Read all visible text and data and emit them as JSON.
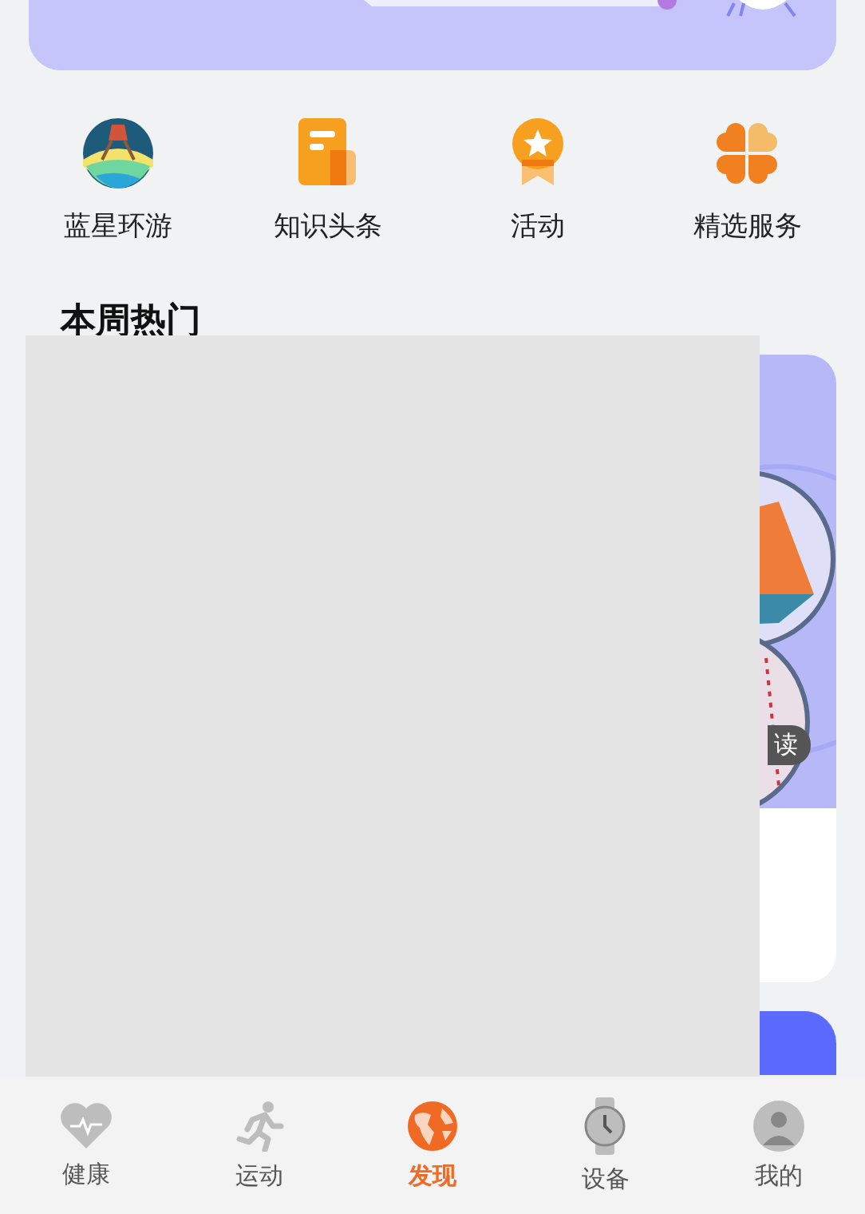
{
  "shortcuts": [
    {
      "kind": "globe",
      "label": "蓝星环游"
    },
    {
      "kind": "document",
      "label": "知识头条"
    },
    {
      "kind": "medal",
      "label": "活动"
    },
    {
      "kind": "clover",
      "label": "精选服务"
    }
  ],
  "section": {
    "title": "本周热门"
  },
  "featured_card": {
    "tag": "读"
  },
  "nav": [
    {
      "kind": "heart",
      "label": "健康",
      "selected": false
    },
    {
      "kind": "runner",
      "label": "运动",
      "selected": false
    },
    {
      "kind": "globe",
      "label": "发现",
      "selected": true
    },
    {
      "kind": "watch",
      "label": "设备",
      "selected": false
    },
    {
      "kind": "person",
      "label": "我的",
      "selected": false
    }
  ]
}
